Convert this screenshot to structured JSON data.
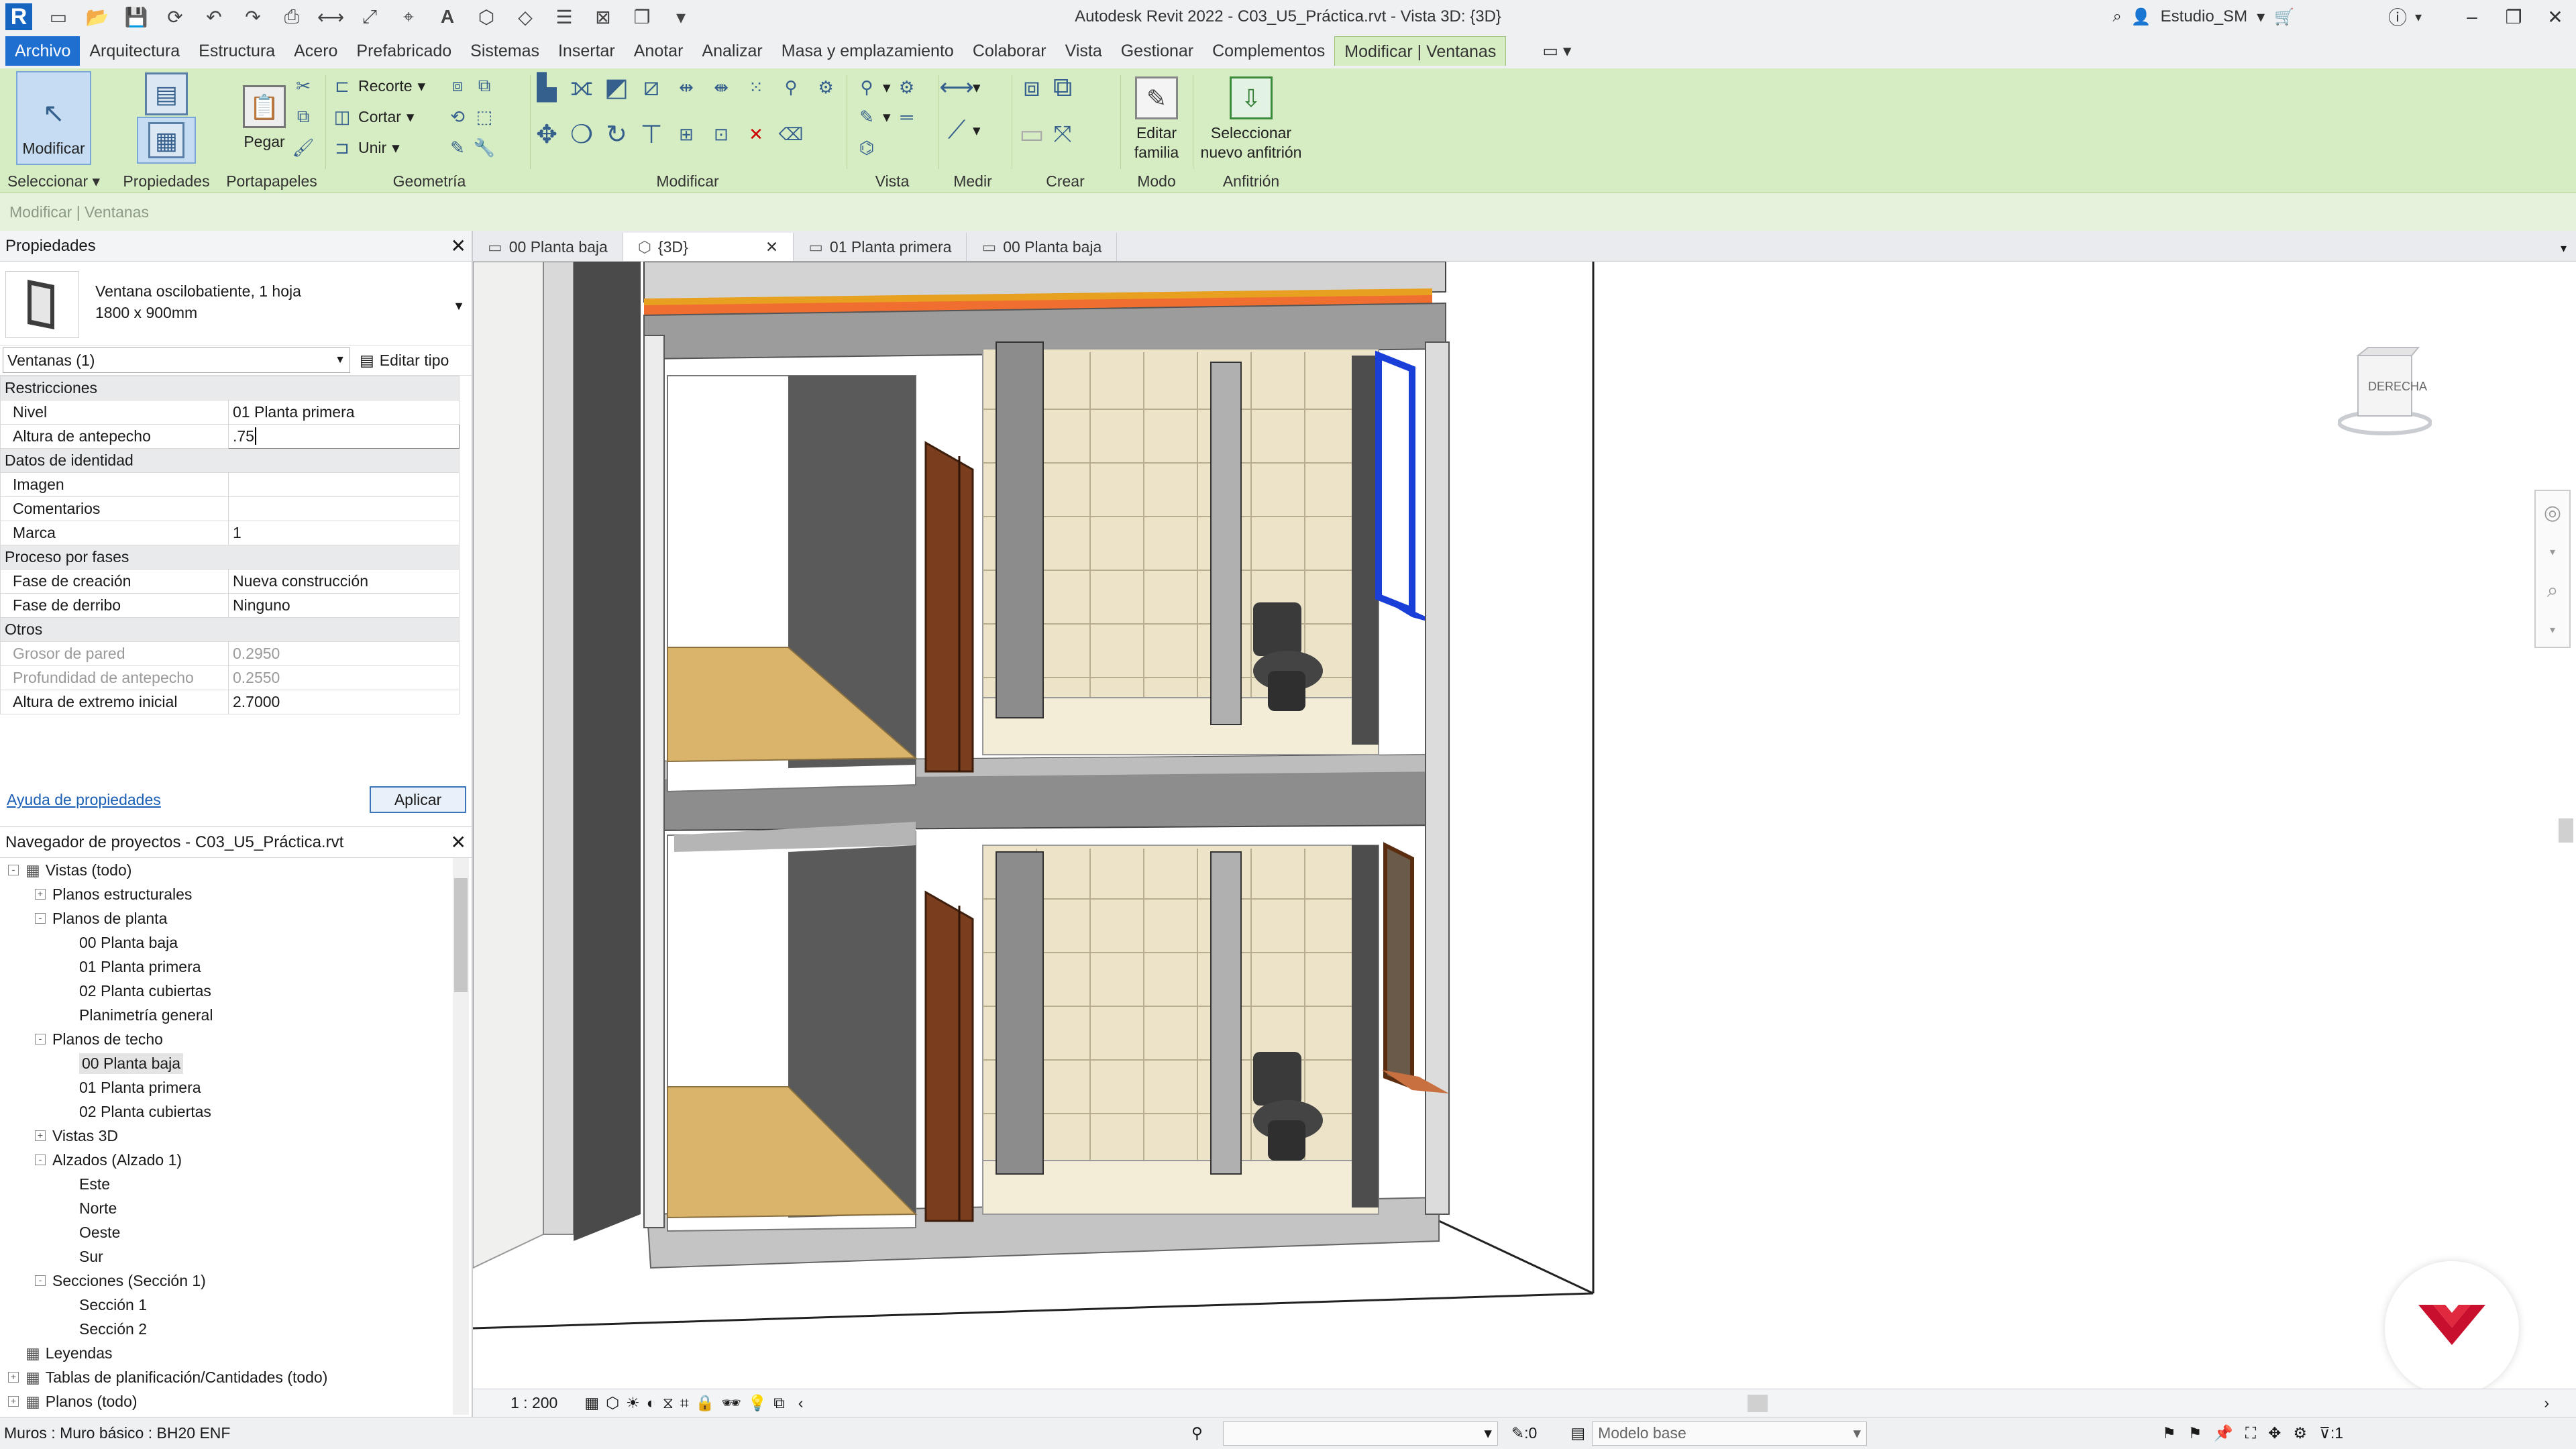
{
  "app": {
    "title": "Autodesk Revit 2022 - C03_U5_Práctica.rvt - Vista 3D: {3D}",
    "user": "Estudio_SM"
  },
  "menu": {
    "tabs": [
      "Archivo",
      "Arquitectura",
      "Estructura",
      "Acero",
      "Prefabricado",
      "Sistemas",
      "Insertar",
      "Anotar",
      "Analizar",
      "Masa y emplazamiento",
      "Colaborar",
      "Vista",
      "Gestionar",
      "Complementos",
      "Modificar | Ventanas"
    ],
    "active_tab": "Modificar | Ventanas"
  },
  "ribbon": {
    "modify_label": "Modificar",
    "properties_label": "Propiedades",
    "paste_label": "Pegar",
    "cut_label": "Recorte",
    "cutg_label": "Cortar",
    "join_label": "Unir",
    "edit_family_label": "Editar familia",
    "select_host_label": "Seleccionar nuevo anfitrión",
    "panels": {
      "select": "Seleccionar",
      "properties": "Propiedades",
      "clipboard": "Portapapeles",
      "geometry": "Geometría",
      "modify": "Modificar",
      "view": "Vista",
      "measure": "Medir",
      "create": "Crear",
      "mode": "Modo",
      "host": "Anfitrión"
    }
  },
  "options_bar": {
    "context": "Modificar | Ventanas"
  },
  "properties": {
    "title": "Propiedades",
    "type_name": "Ventana oscilobatiente, 1 hoja",
    "type_size": "1800 x 900mm",
    "instance_selector": "Ventanas (1)",
    "edit_type": "Editar tipo",
    "help_link": "Ayuda de propiedades",
    "apply": "Aplicar",
    "groups": [
      {
        "name": "Restricciones",
        "rows": [
          {
            "k": "Nivel",
            "v": "01 Planta primera"
          },
          {
            "k": "Altura de antepecho",
            "v": ".75"
          }
        ]
      },
      {
        "name": "Datos de identidad",
        "rows": [
          {
            "k": "Imagen",
            "v": ""
          },
          {
            "k": "Comentarios",
            "v": ""
          },
          {
            "k": "Marca",
            "v": "1"
          }
        ]
      },
      {
        "name": "Proceso por fases",
        "rows": [
          {
            "k": "Fase de creación",
            "v": "Nueva construcción"
          },
          {
            "k": "Fase de derribo",
            "v": "Ninguno"
          }
        ]
      },
      {
        "name": "Otros",
        "rows": [
          {
            "k": "Grosor de pared",
            "v": "0.2950",
            "disabled": true
          },
          {
            "k": "Profundidad de antepecho",
            "v": "0.2550",
            "disabled": true
          },
          {
            "k": "Altura de extremo inicial",
            "v": "2.7000"
          }
        ]
      }
    ]
  },
  "browser": {
    "title": "Navegador de proyectos - C03_U5_Práctica.rvt",
    "tree": [
      {
        "label": "Vistas (todo)",
        "level": 0,
        "tog": "-",
        "icon": true
      },
      {
        "label": "Planos estructurales",
        "level": 1,
        "tog": "+"
      },
      {
        "label": "Planos de planta",
        "level": 1,
        "tog": "-"
      },
      {
        "label": "00 Planta baja",
        "level": 2
      },
      {
        "label": "01 Planta primera",
        "level": 2
      },
      {
        "label": "02 Planta cubiertas",
        "level": 2
      },
      {
        "label": "Planimetría general",
        "level": 2
      },
      {
        "label": "Planos de techo",
        "level": 1,
        "tog": "-"
      },
      {
        "label": "00 Planta baja",
        "level": 2,
        "selected": true
      },
      {
        "label": "01 Planta primera",
        "level": 2
      },
      {
        "label": "02 Planta cubiertas",
        "level": 2
      },
      {
        "label": "Vistas 3D",
        "level": 1,
        "tog": "+"
      },
      {
        "label": "Alzados (Alzado 1)",
        "level": 1,
        "tog": "-"
      },
      {
        "label": "Este",
        "level": 2
      },
      {
        "label": "Norte",
        "level": 2
      },
      {
        "label": "Oeste",
        "level": 2
      },
      {
        "label": "Sur",
        "level": 2
      },
      {
        "label": "Secciones (Sección 1)",
        "level": 1,
        "tog": "-"
      },
      {
        "label": "Sección 1",
        "level": 2
      },
      {
        "label": "Sección 2",
        "level": 2
      },
      {
        "label": "Leyendas",
        "level": 0,
        "icon": true
      },
      {
        "label": "Tablas de planificación/Cantidades (todo)",
        "level": 0,
        "tog": "+",
        "icon": true
      },
      {
        "label": "Planos (todo)",
        "level": 0,
        "tog": "+",
        "icon": true
      }
    ]
  },
  "view_tabs": [
    {
      "label": "00 Planta baja",
      "active": false
    },
    {
      "label": "{3D}",
      "active": true,
      "closable": true
    },
    {
      "label": "01 Planta primera",
      "active": false
    },
    {
      "label": "00 Planta baja",
      "active": false
    }
  ],
  "viewcube": {
    "face": "DERECHA"
  },
  "view_control": {
    "scale": "1 : 200"
  },
  "status": {
    "message": "Muros : Muro básico : BH20 ENF",
    "workset_count": ":0",
    "design_model": "Modelo base",
    "filter_count": ":1"
  },
  "colors": {
    "ribbon_bg": "#d6ecc3",
    "file_tab": "#1f6fd0",
    "selection_blue": "#1a3fd8",
    "brand_red": "#c8102e"
  }
}
